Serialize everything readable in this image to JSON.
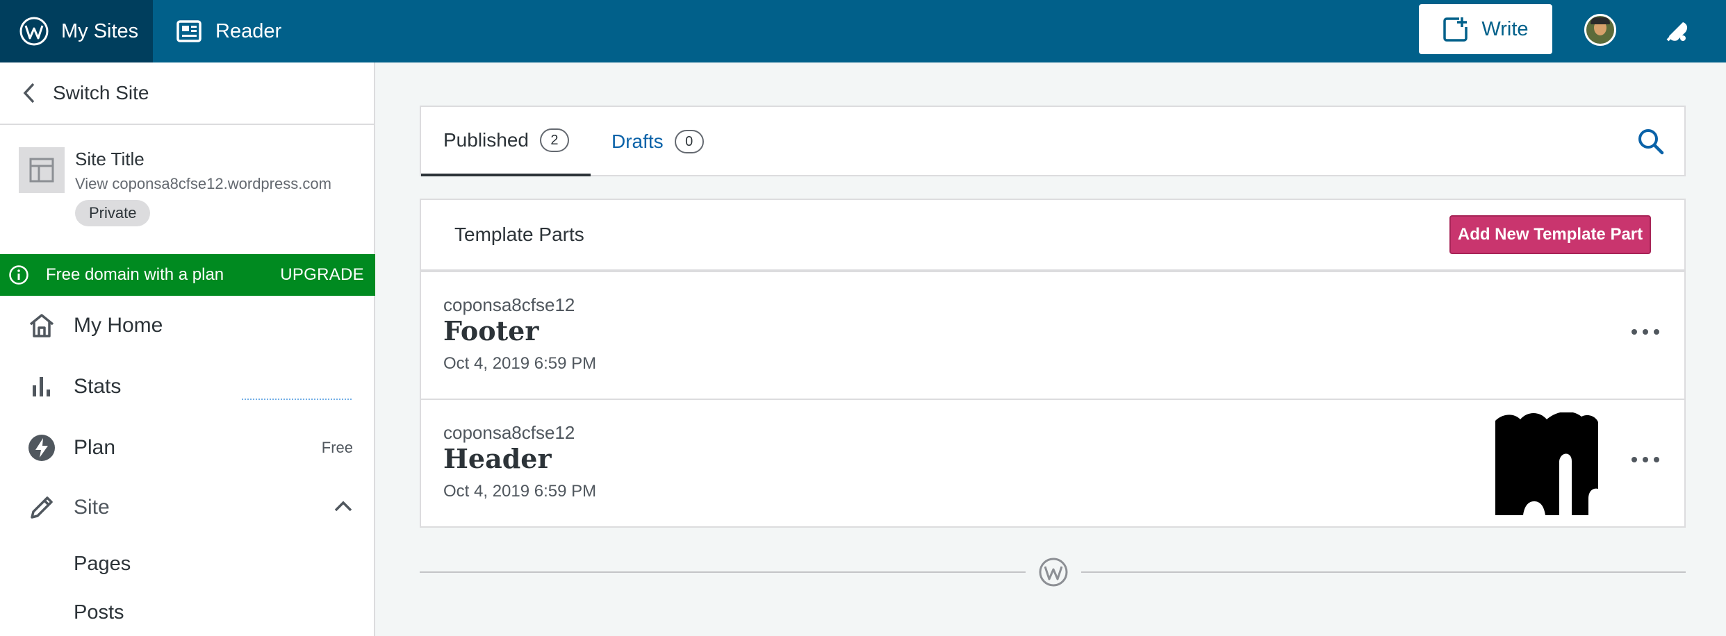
{
  "masterbar": {
    "my_sites": "My Sites",
    "reader": "Reader",
    "write": "Write"
  },
  "sidebar": {
    "switch_site": "Switch Site",
    "site_title": "Site Title",
    "site_url": "View coponsa8cfse12.wordpress.com",
    "privacy_badge": "Private",
    "upsell_text": "Free domain with a plan",
    "upsell_cta": "UPGRADE",
    "nav": {
      "my_home": "My Home",
      "stats": "Stats",
      "plan": "Plan",
      "plan_value": "Free",
      "site": "Site"
    },
    "sub": {
      "pages": "Pages",
      "posts": "Posts"
    }
  },
  "tabs": {
    "published_label": "Published",
    "published_count": "2",
    "drafts_label": "Drafts",
    "drafts_count": "0"
  },
  "section": {
    "title": "Template Parts",
    "add_button": "Add New Template Part"
  },
  "posts": [
    {
      "author": "coponsa8cfse12",
      "title": "Footer",
      "date": "Oct 4, 2019 6:59 PM"
    },
    {
      "author": "coponsa8cfse12",
      "title": "Header",
      "date": "Oct 4, 2019 6:59 PM"
    }
  ],
  "colors": {
    "masterbar": "#01608a",
    "masterbar_active": "#003e5d",
    "upsell": "#008a20",
    "primary_button": "#c9356e",
    "link": "#0a62a8"
  }
}
